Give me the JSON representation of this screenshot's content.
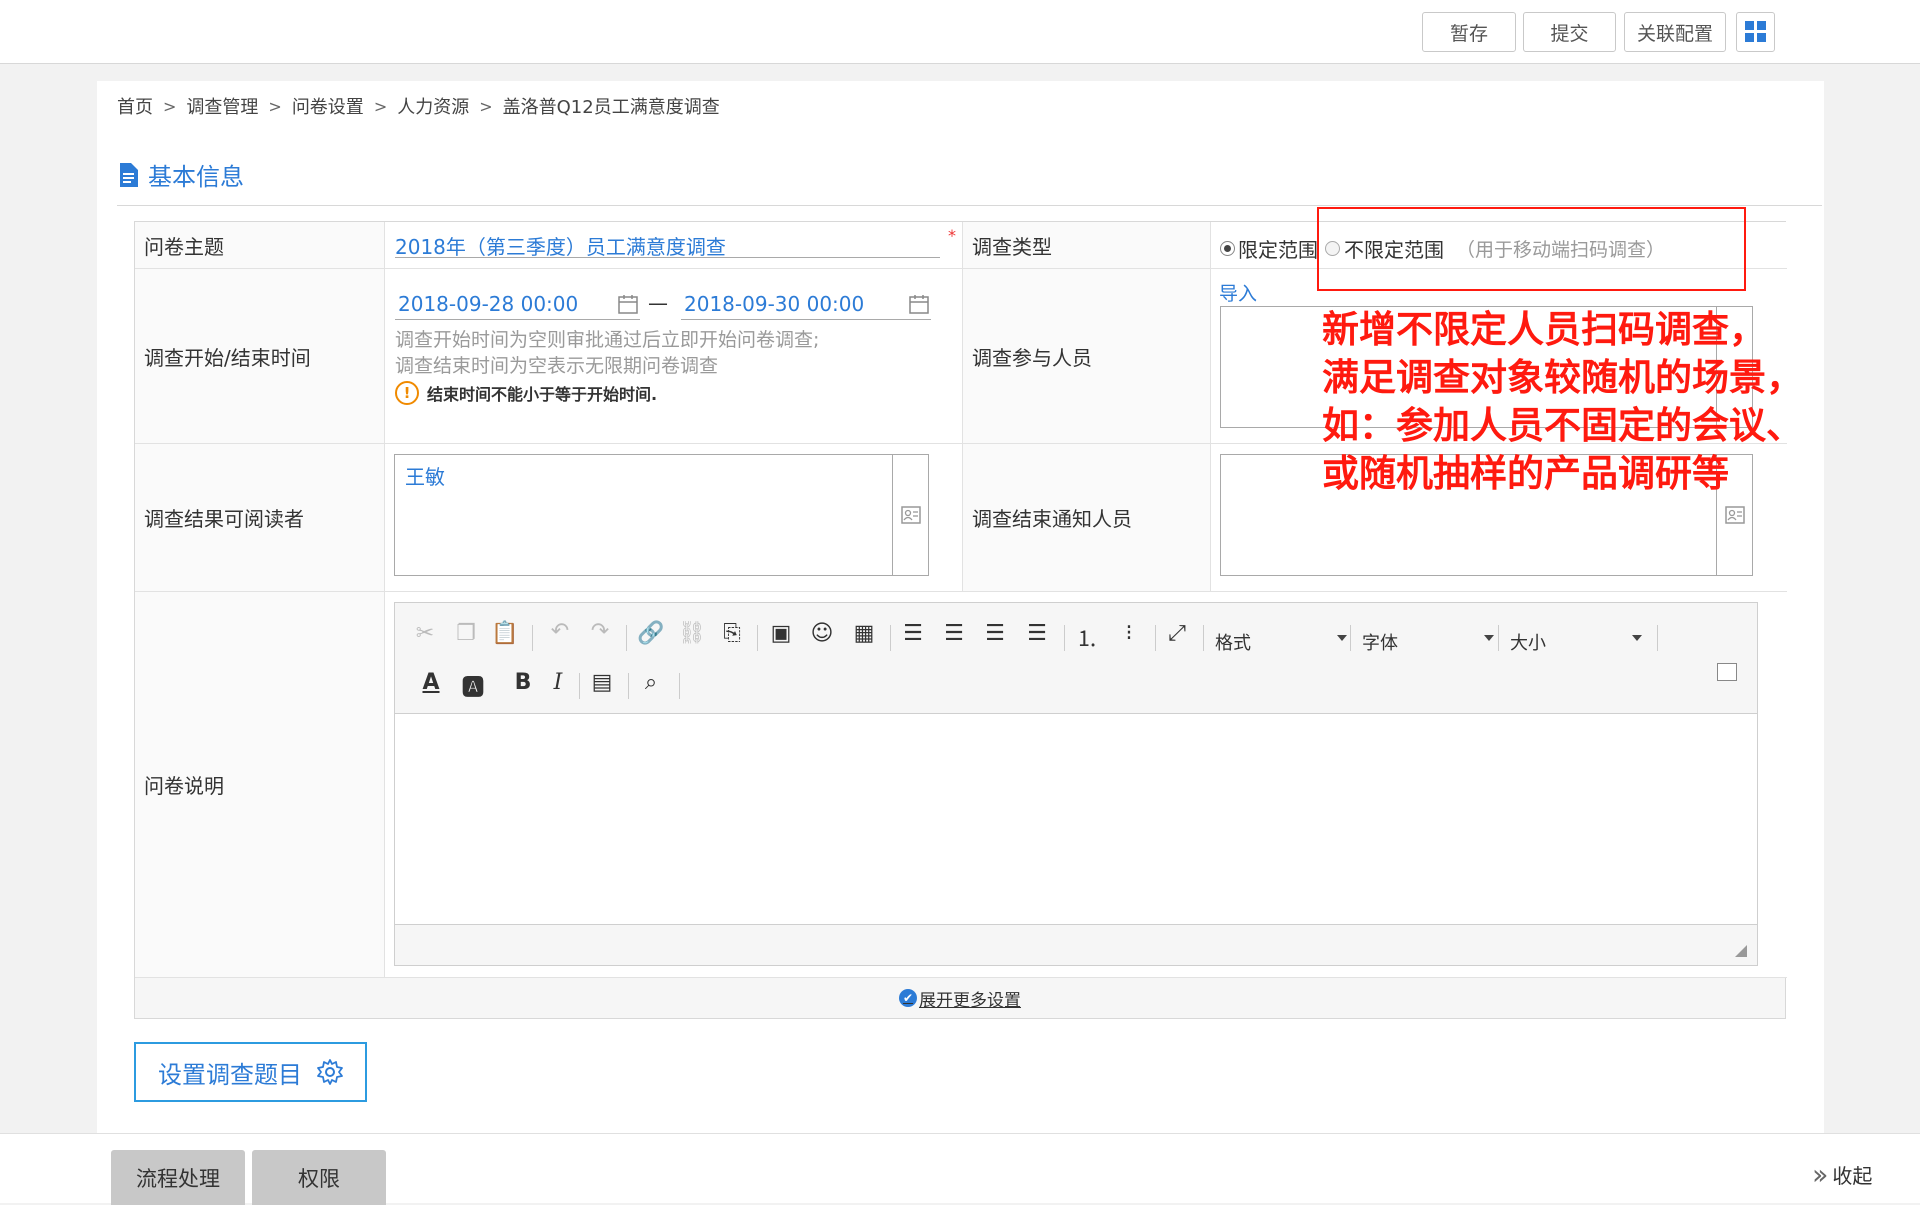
{
  "toolbar": {
    "save_draft": "暂存",
    "submit": "提交",
    "link_config": "关联配置"
  },
  "breadcrumb": [
    "首页",
    "调查管理",
    "问卷设置",
    "人力资源",
    "盖洛普Q12员工满意度调查"
  ],
  "breadcrumb_sep": ">",
  "section_title": "基本信息",
  "form": {
    "subject_label": "问卷主题",
    "subject_value": "2018年（第三季度）员工满意度调查",
    "required_mark": "*",
    "type_label": "调查类型",
    "type_option_limited": "限定范围",
    "type_option_unlimited": "不限定范围",
    "type_hint": "（用于移动端扫码调查）",
    "time_label": "调查开始/结束时间",
    "start_time": "2018-09-28 00:00",
    "time_dash": "—",
    "end_time": "2018-09-30 00:00",
    "time_hint_1": "调查开始时间为空则审批通过后立即开始问卷调查;",
    "time_hint_2": "调查结束时间为空表示无限期问卷调查",
    "time_error": "结束时间不能小于等于开始时间.",
    "participants_label": "调查参与人员",
    "import_link": "导入",
    "readers_label": "调查结果可阅读者",
    "readers_value": "王敏",
    "notify_label": "调查结束通知人员",
    "desc_label": "问卷说明",
    "expand_more": "展开更多设置"
  },
  "editor": {
    "format_label": "格式",
    "font_label": "字体",
    "size_label": "大小"
  },
  "set_questions_button": "设置调查题目",
  "annotation": {
    "line1": "新增不限定人员扫码调查，",
    "line2": "满足调查对象较随机的场景，",
    "line3": "如：参加人员不固定的会议、",
    "line4": "或随机抽样的产品调研等",
    "color": "#ff1a0f"
  },
  "bottom": {
    "tab_flow": "流程处理",
    "tab_permission": "权限",
    "collapse": "收起"
  },
  "colors": {
    "accent": "#2c7bd6",
    "error": "#f08a00"
  }
}
